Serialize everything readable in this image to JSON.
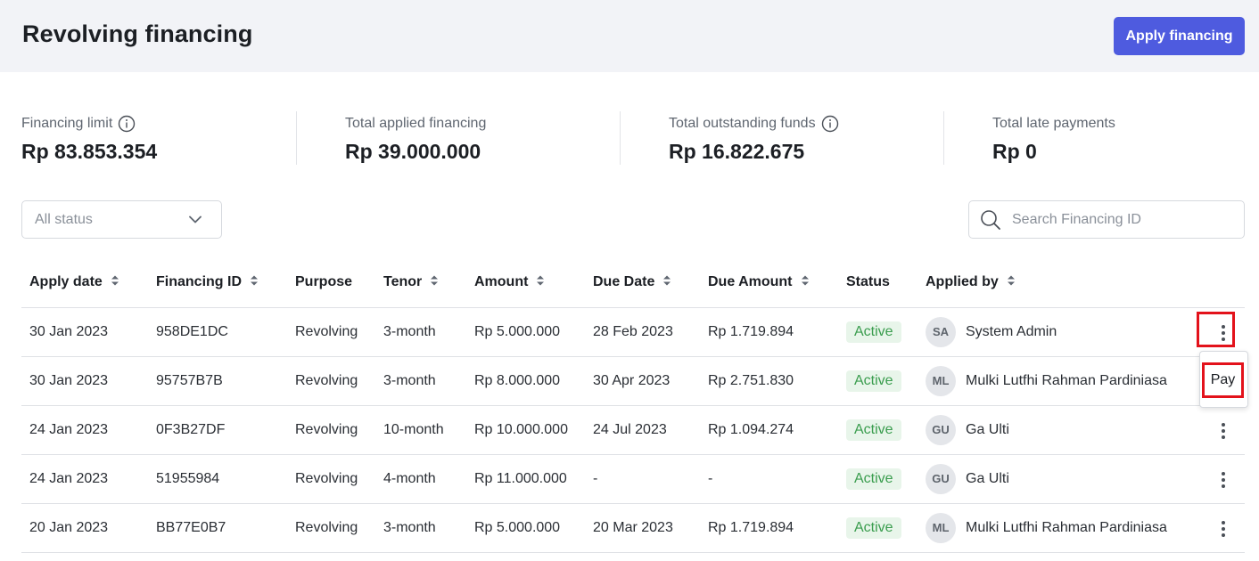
{
  "header": {
    "title": "Revolving financing",
    "apply_button": "Apply financing"
  },
  "stats": [
    {
      "label": "Financing limit",
      "value": "Rp 83.853.354",
      "has_info": true
    },
    {
      "label": "Total applied financing",
      "value": "Rp 39.000.000",
      "has_info": false
    },
    {
      "label": "Total outstanding funds",
      "value": "Rp 16.822.675",
      "has_info": true
    },
    {
      "label": "Total late payments",
      "value": "Rp 0",
      "has_info": false
    }
  ],
  "filters": {
    "status_select": {
      "value": "All status"
    },
    "search": {
      "placeholder": "Search Financing ID"
    }
  },
  "table": {
    "columns": [
      "Apply date",
      "Financing ID",
      "Purpose",
      "Tenor",
      "Amount",
      "Due Date",
      "Due Amount",
      "Status",
      "Applied by"
    ],
    "rows": [
      {
        "apply_date": "30 Jan 2023",
        "financing_id": "958DE1DC",
        "purpose": "Revolving",
        "tenor": "3-month",
        "amount": "Rp 5.000.000",
        "due_date": "28 Feb 2023",
        "due_amount": "Rp 1.719.894",
        "status": "Active",
        "initials": "SA",
        "applied_by": "System Admin"
      },
      {
        "apply_date": "30 Jan 2023",
        "financing_id": "95757B7B",
        "purpose": "Revolving",
        "tenor": "3-month",
        "amount": "Rp 8.000.000",
        "due_date": "30 Apr 2023",
        "due_amount": "Rp 2.751.830",
        "status": "Active",
        "initials": "ML",
        "applied_by": "Mulki Lutfhi Rahman Pardiniasa"
      },
      {
        "apply_date": "24 Jan 2023",
        "financing_id": "0F3B27DF",
        "purpose": "Revolving",
        "tenor": "10-month",
        "amount": "Rp 10.000.000",
        "due_date": "24 Jul 2023",
        "due_amount": "Rp 1.094.274",
        "status": "Active",
        "initials": "GU",
        "applied_by": "Ga Ulti"
      },
      {
        "apply_date": "24 Jan 2023",
        "financing_id": "51955984",
        "purpose": "Revolving",
        "tenor": "4-month",
        "amount": "Rp 11.000.000",
        "due_date": "-",
        "due_amount": "-",
        "status": "Active",
        "initials": "GU",
        "applied_by": "Ga Ulti"
      },
      {
        "apply_date": "20 Jan 2023",
        "financing_id": "BB77E0B7",
        "purpose": "Revolving",
        "tenor": "3-month",
        "amount": "Rp 5.000.000",
        "due_date": "20 Mar 2023",
        "due_amount": "Rp 1.719.894",
        "status": "Active",
        "initials": "ML",
        "applied_by": "Mulki Lutfhi Rahman Pardiniasa"
      }
    ]
  },
  "row_menu": {
    "pay_label": "Pay"
  },
  "colors": {
    "accent": "#4e5bdf",
    "active_badge_bg": "#e8f5ea",
    "active_badge_text": "#3a9d4e",
    "highlight": "#e3121b"
  }
}
